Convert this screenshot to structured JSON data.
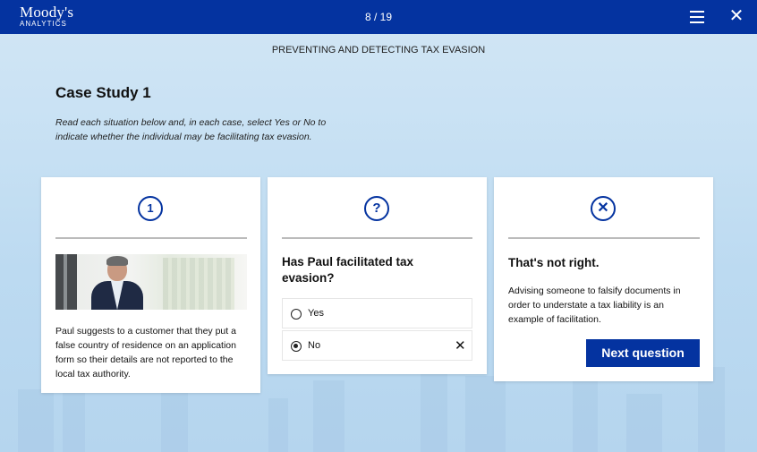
{
  "header": {
    "logo_main": "Moody's",
    "logo_sub": "ANALYTICS",
    "progress": "8 / 19",
    "menu_icon": "hamburger-menu-icon",
    "close_icon": "close-icon",
    "bar_color": "#0433a0"
  },
  "module_title": "PREVENTING AND DETECTING TAX EVASION",
  "case": {
    "title": "Case Study 1",
    "instructions": "Read each situation below and, in each case, select Yes or No to indicate whether the individual may be facilitating tax evasion."
  },
  "scenario_card": {
    "icon_text": "1",
    "icon": "number-one-circle-icon",
    "photo": "businessman-on-phone",
    "text": "Paul suggests to a customer that they put a false country of residence on an application form so their details are not reported to the local tax authority."
  },
  "question_card": {
    "icon_text": "?",
    "icon": "question-circle-icon",
    "question": "Has Paul facilitated tax evasion?",
    "options": [
      {
        "label": "Yes",
        "selected": false,
        "mark": ""
      },
      {
        "label": "No",
        "selected": true,
        "mark": "✕"
      }
    ]
  },
  "feedback_card": {
    "icon_text": "✕",
    "icon": "incorrect-circle-icon",
    "title": "That's not right.",
    "text": "Advising someone to falsify documents in order to understate a tax liability is an example of facilitation.",
    "button_label": "Next question"
  }
}
